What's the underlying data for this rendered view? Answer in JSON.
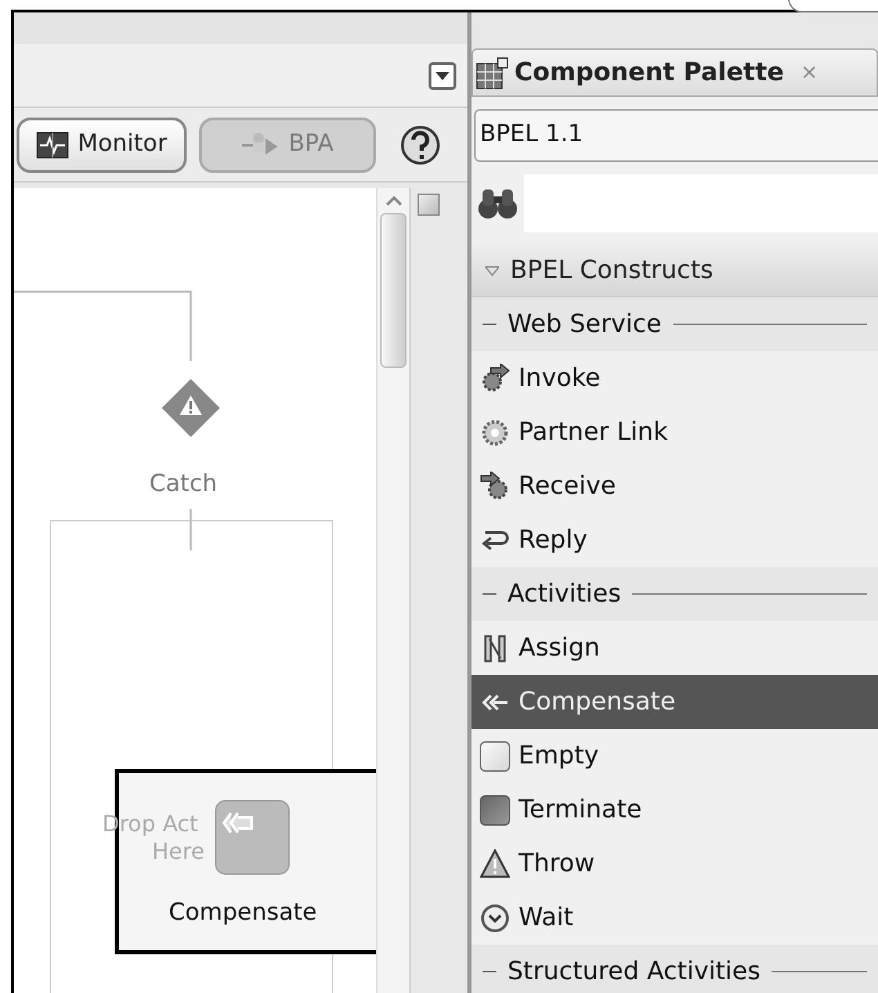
{
  "editor": {
    "toolbar": [
      {
        "label": "Monitor",
        "disabled": false
      },
      {
        "label": "BPA",
        "disabled": true
      }
    ],
    "canvas": {
      "catch_label": "Catch",
      "drop_hint": [
        "Drop Act",
        "Here"
      ],
      "drag_label": "Compensate"
    }
  },
  "palette": {
    "title": "Component Palette",
    "close": "×",
    "library": "BPEL 1.1",
    "section": {
      "label": "BPEL Constructs",
      "expanded": true
    },
    "items": [
      {
        "kind": "group",
        "label": "Web Service"
      },
      {
        "kind": "item",
        "label": "Invoke",
        "selected": false
      },
      {
        "kind": "item",
        "label": "Partner Link",
        "selected": false
      },
      {
        "kind": "item",
        "label": "Receive",
        "selected": false
      },
      {
        "kind": "item",
        "label": "Reply",
        "selected": false
      },
      {
        "kind": "group",
        "label": "Activities"
      },
      {
        "kind": "item",
        "label": "Assign",
        "selected": false
      },
      {
        "kind": "item",
        "label": "Compensate",
        "selected": true
      },
      {
        "kind": "item",
        "label": "Empty",
        "selected": false
      },
      {
        "kind": "item",
        "label": "Terminate",
        "selected": false
      },
      {
        "kind": "item",
        "label": "Throw",
        "selected": false
      },
      {
        "kind": "item",
        "label": "Wait",
        "selected": false
      },
      {
        "kind": "group",
        "label": "Structured Activities"
      }
    ]
  }
}
